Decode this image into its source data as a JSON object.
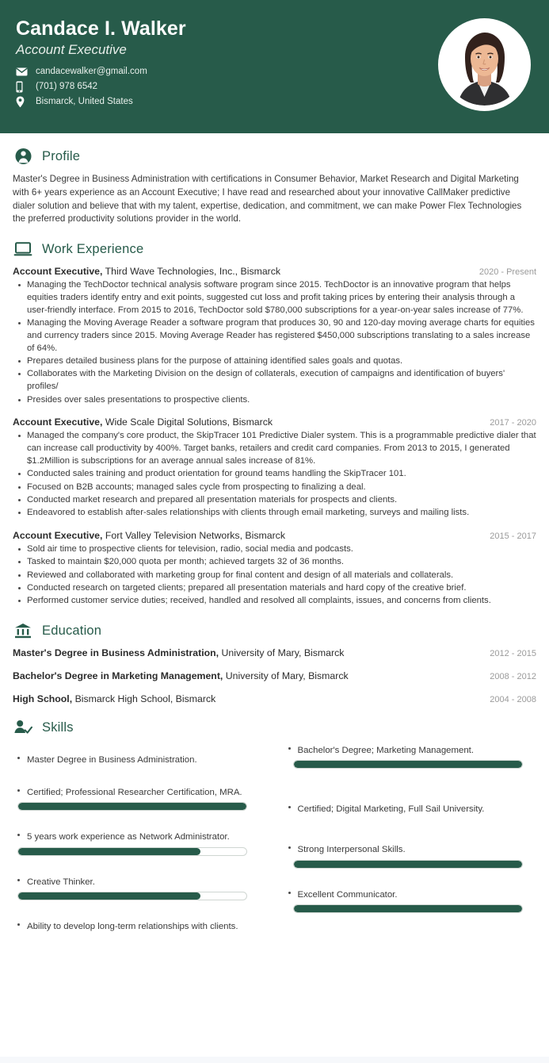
{
  "header": {
    "name": "Candace I. Walker",
    "role": "Account Executive",
    "accent_color": "#275b4a",
    "contacts": [
      {
        "icon": "envelope-icon",
        "value": "candacewalker@gmail.com"
      },
      {
        "icon": "mobile-phone-icon",
        "value": "(701) 978 6542"
      },
      {
        "icon": "location-pin-icon",
        "value": "Bismarck, United States"
      }
    ],
    "photo_alt": "profile-photo"
  },
  "sections": {
    "profile": {
      "icon": "user-circle-icon",
      "title": "Profile",
      "text": "Master's Degree in Business Administration with certifications in Consumer Behavior, Market Research and Digital Marketing with 6+ years experience as an Account Executive; I have read and researched about your innovative CallMaker predictive dialer solution and believe that with my talent, expertise, dedication, and commitment, we can make Power Flex Technologies the preferred productivity solutions provider in the world."
    },
    "work": {
      "icon": "laptop-icon",
      "title": "Work Experience",
      "jobs": [
        {
          "role": "Account Executive,",
          "org": " Third Wave Technologies, Inc., Bismarck",
          "dates": "2020 - Present",
          "bullets": [
            "Managing the TechDoctor technical analysis software program since 2015. TechDoctor is an innovative program that helps equities traders identify entry and exit points, suggested cut loss and profit taking prices by entering their analysis through a user-friendly interface. From 2015 to 2016, TechDoctor sold $780,000 subscriptions for a year-on-year sales increase of 77%.",
            "Managing the Moving Average Reader a software program that produces 30, 90 and 120-day moving average charts for equities and currency traders since 2015. Moving Average Reader has registered $450,000 subscriptions translating to a sales increase of 64%.",
            "Prepares detailed business plans for the purpose of attaining identified sales goals and quotas.",
            "Collaborates with the Marketing Division on the design of collaterals, execution of campaigns and identification of buyers' profiles/",
            "Presides over sales presentations to prospective clients."
          ]
        },
        {
          "role": "Account Executive,",
          "org": " Wide Scale Digital Solutions, Bismarck",
          "dates": "2017 - 2020",
          "bullets": [
            "Managed the company's core product, the SkipTracer 101 Predictive Dialer system. This is a programmable predictive dialer that can increase call productivity by 400%. Target banks, retailers and credit card companies. From 2013 to 2015, I generated $1.2Million is subscriptions for an average annual sales increase of 81%.",
            "Conducted sales training and product orientation for ground teams handling the SkipTracer 101.",
            "Focused on B2B accounts; managed sales cycle from prospecting to finalizing a deal.",
            "Conducted market research and prepared all presentation materials for prospects and clients.",
            "Endeavored to establish after-sales relationships with clients through email marketing, surveys and mailing lists."
          ]
        },
        {
          "role": "Account Executive,",
          "org": " Fort Valley Television Networks, Bismarck",
          "dates": "2015 - 2017",
          "bullets": [
            "Sold air time to prospective clients for television, radio, social media and podcasts.",
            "Tasked to maintain $20,000 quota per month; achieved targets 32 of 36 months.",
            "Reviewed and collaborated with marketing group for final content and design of all materials and collaterals.",
            "Conducted research on targeted clients; prepared all presentation materials and hard copy of the creative brief.",
            "Performed customer service duties; received, handled and resolved all complaints, issues, and concerns from clients."
          ]
        }
      ]
    },
    "education": {
      "icon": "bank-building-icon",
      "title": "Education",
      "items": [
        {
          "degree": "Master's Degree in Business Administration,",
          "school": " University of Mary, Bismarck",
          "dates": "2012 - 2015"
        },
        {
          "degree": "Bachelor's Degree in Marketing Management,",
          "school": " University of Mary, Bismarck",
          "dates": "2008 - 2012"
        },
        {
          "degree": "High School,",
          "school": " Bismarck High School, Bismarck",
          "dates": "2004 - 2008"
        }
      ]
    },
    "skills": {
      "icon": "user-check-icon",
      "title": "Skills",
      "bar_color": "#275b4a",
      "left_column": [
        {
          "label": "Master Degree in Business Administration.",
          "bar": false,
          "level": null
        },
        {
          "label": "Certified; Professional Researcher Certification, MRA.",
          "bar": true,
          "level": 100
        },
        {
          "label": "5 years work experience as Network Administrator.",
          "bar": true,
          "level": 80
        },
        {
          "label": "Creative Thinker.",
          "bar": true,
          "level": 80
        },
        {
          "label": "Ability to develop long-term relationships with clients.",
          "bar": false,
          "level": null
        }
      ],
      "right_column": [
        {
          "label": "Bachelor's Degree; Marketing Management.",
          "bar": true,
          "level": 100
        },
        {
          "label": "Certified; Digital Marketing, Full Sail University.",
          "bar": false,
          "level": null
        },
        {
          "label": "Strong Interpersonal Skills.",
          "bar": true,
          "level": 100
        },
        {
          "label": "Excellent Communicator.",
          "bar": true,
          "level": 100
        }
      ]
    }
  }
}
